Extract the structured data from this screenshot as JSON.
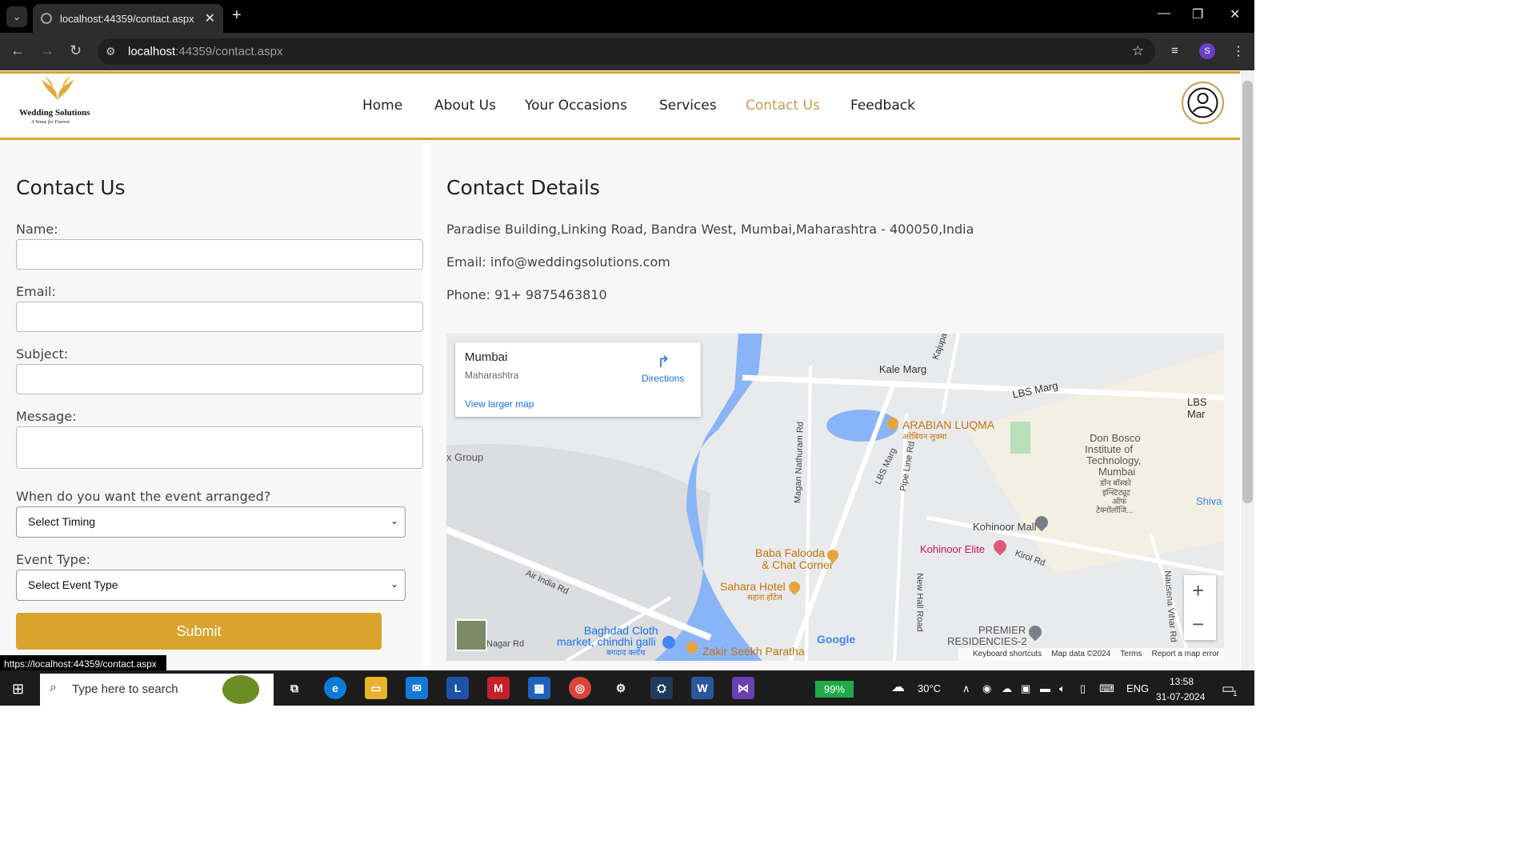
{
  "browser": {
    "tab_title": "localhost:44359/contact.aspx",
    "url_host": "localhost",
    "url_rest": ":44359/contact.aspx",
    "status_url": "https://localhost:44359/contact.aspx",
    "profile_initial": "S"
  },
  "site": {
    "logo_name": "Wedding Solutions",
    "logo_tagline": "A Venue for Forever.",
    "nav": [
      "Home",
      "About Us",
      "Your Occasions",
      "Services",
      "Contact Us",
      "Feedback"
    ],
    "active_nav": "Contact Us",
    "accent_color": "#d9a531"
  },
  "form": {
    "heading": "Contact Us",
    "name_label": "Name:",
    "email_label": "Email:",
    "subject_label": "Subject:",
    "message_label": "Message:",
    "timing_label": "When do you want the event arranged?",
    "timing_selected": "Select Timing",
    "type_label": "Event Type:",
    "type_selected": "Select Event Type",
    "submit": "Submit"
  },
  "details": {
    "heading": "Contact Details",
    "address": "Paradise Building,Linking Road, Bandra West, Mumbai,Maharashtra - 400050,India",
    "email": "Email: info@weddingsolutions.com",
    "phone": "Phone: 91+ 9875463810"
  },
  "map": {
    "place": "Mumbai",
    "region": "Maharashtra",
    "directions": "Directions",
    "larger": "View larger map",
    "labels": [
      "Kale Marg",
      "Kajupa",
      "LBS Marg",
      "LBS Mar",
      "ARABIAN LUQMA",
      "अरेबियन लुक्मा",
      "Don Bosco",
      "Institute of",
      "Technology,",
      "Mumbai",
      "डॉन बॉस्को",
      "इन्स्टिट्यूट",
      "ऑफ",
      "टेक्नॉलॉजि...",
      "x Group",
      "Magan Nathuram Rd",
      "LBS Marg",
      "Pipe Line Rd",
      "Shiva",
      "Kohinoor Mall",
      "Kohinoor Elite",
      "Kirol Rd",
      "Baba Falooda",
      "& Chat Corner",
      "Air India Rd",
      "Sahara Hotel",
      "सहारा हॉटेल",
      "New Hall Road",
      "Nausena Vihar Rd",
      "Baghdad Cloth",
      "market, chindhi galli",
      "बगदाद क्लॉथ",
      "Nagar Rd",
      "Zakir Seekh Paratha",
      "PREMIER",
      "RESIDENCIES-2",
      "Google"
    ],
    "footer": [
      "Keyboard shortcuts",
      "Map data ©2024",
      "Terms",
      "Report a map error"
    ],
    "zoom_in": "+",
    "zoom_out": "−"
  },
  "taskbar": {
    "search_placeholder": "Type here to search",
    "battery": "99%",
    "temperature": "30°C",
    "language": "ENG",
    "time": "13:58",
    "date": "31-07-2024",
    "notifications": "1"
  }
}
